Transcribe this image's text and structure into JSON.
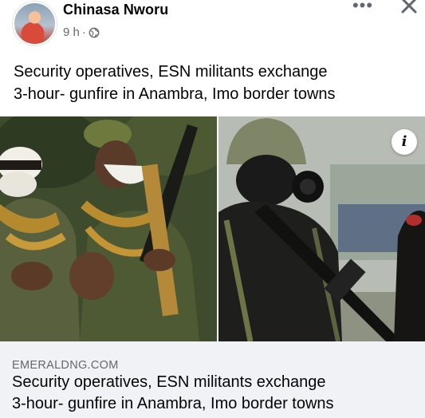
{
  "post": {
    "author": "Chinasa Nworu",
    "time": "9 h",
    "separator": "·",
    "privacy_icon": "globe-icon",
    "more_icon": "more-options-icon",
    "more_label": "•••",
    "close_icon": "close-icon",
    "text_line1": "Security operatives, ESN militants exchange",
    "text_line2": "3-hour- gunfire in Anambra, Imo border towns"
  },
  "media": {
    "info_label": "i"
  },
  "link_preview": {
    "domain": "EMERALDNG.COM",
    "title_line1": "Security operatives, ESN militants exchange",
    "title_line2": "3-hour- gunfire in Anambra, Imo border towns"
  },
  "colors": {
    "link_background": "#f0f2f5",
    "meta_text": "#65676b",
    "primary_text": "#050505"
  }
}
